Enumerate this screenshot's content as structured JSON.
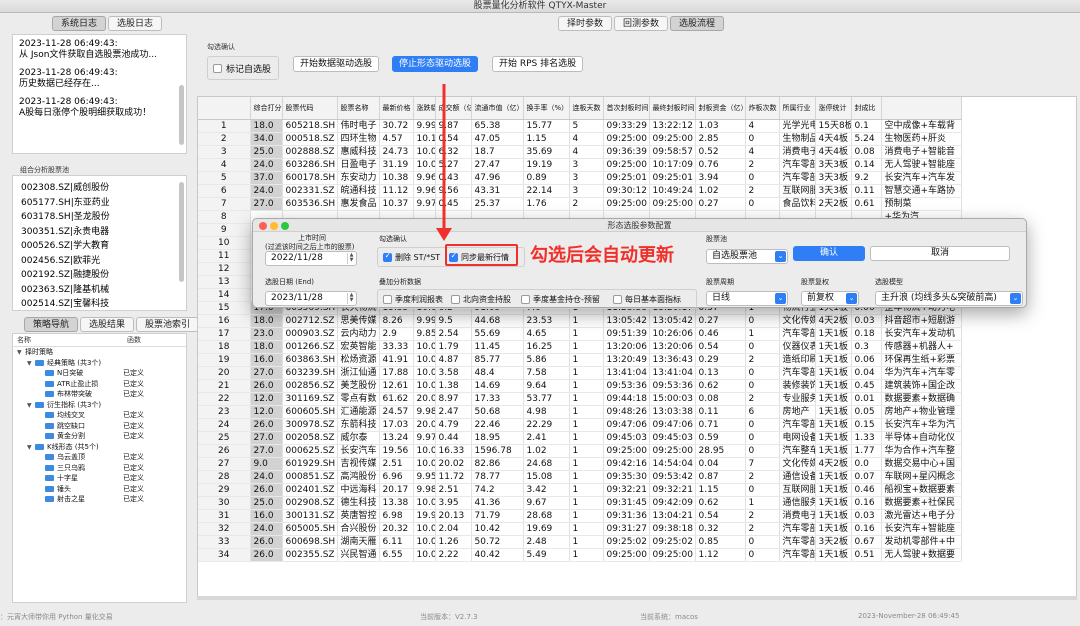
{
  "window": {
    "title": "股票量化分析软件 QTYX-Master"
  },
  "left_tabs": [
    "系统日志",
    "选股日志"
  ],
  "left_tabs_active": 0,
  "top_tabs": [
    "择时参数",
    "回测参数",
    "选股流程"
  ],
  "top_tabs_active": 2,
  "log_entries": [
    {
      "time": "2023-11-28 06:49:43:",
      "msg": "从 Json文件获取自选股票池成功..."
    },
    {
      "time": "2023-11-28 06:49:43:",
      "msg": "历史数据已经存在..."
    },
    {
      "time": "2023-11-28 06:49:43:",
      "msg": "A股每日涨停个股明细获取成功！"
    }
  ],
  "combo_pool_title": "组合分析股票池",
  "stock_pool": [
    "002308.SZ|威创股份",
    "605177.SH|东亚药业",
    "603178.SH|圣龙股份",
    "300351.SZ|永贵电器",
    "000526.SZ|学大教育",
    "002456.SZ|欧菲光",
    "002192.SZ|融捷股份",
    "002363.SZ|隆基机械",
    "002514.SZ|宝馨科技"
  ],
  "strategy_tabs": [
    "策略导航",
    "选股结果",
    "股票池索引"
  ],
  "strategy_tabs_active": 0,
  "tree": {
    "headers": [
      "名称",
      "函数"
    ],
    "rows": [
      {
        "level": 0,
        "arrow": "▼",
        "folder": false,
        "name": "择时策略",
        "type": ""
      },
      {
        "level": 1,
        "arrow": "▼",
        "folder": true,
        "name": "经典策略 (共3个)",
        "type": ""
      },
      {
        "level": 2,
        "arrow": "",
        "folder": true,
        "name": "N日突破",
        "type": "已定义"
      },
      {
        "level": 2,
        "arrow": "",
        "folder": true,
        "name": "ATR止盈止损",
        "type": "已定义"
      },
      {
        "level": 2,
        "arrow": "",
        "folder": true,
        "name": "布林带突破",
        "type": "已定义"
      },
      {
        "level": 1,
        "arrow": "▼",
        "folder": true,
        "name": "衍生指标 (共3个)",
        "type": ""
      },
      {
        "level": 2,
        "arrow": "",
        "folder": true,
        "name": "均线交叉",
        "type": "已定义"
      },
      {
        "level": 2,
        "arrow": "",
        "folder": true,
        "name": "跳空缺口",
        "type": "已定义"
      },
      {
        "level": 2,
        "arrow": "",
        "folder": true,
        "name": "黄金分割",
        "type": "已定义"
      },
      {
        "level": 1,
        "arrow": "▼",
        "folder": true,
        "name": "K线形态 (共5个)",
        "type": ""
      },
      {
        "level": 2,
        "arrow": "",
        "folder": true,
        "name": "乌云盖顶",
        "type": "已定义"
      },
      {
        "level": 2,
        "arrow": "",
        "folder": true,
        "name": "三只乌鸦",
        "type": "已定义"
      },
      {
        "level": 2,
        "arrow": "",
        "folder": true,
        "name": "十字星",
        "type": "已定义"
      },
      {
        "level": 2,
        "arrow": "",
        "folder": true,
        "name": "锤头",
        "type": "已定义"
      },
      {
        "level": 2,
        "arrow": "",
        "folder": true,
        "name": "射击之星",
        "type": "已定义"
      }
    ]
  },
  "select_box": {
    "title": "勾选确认",
    "mark_label": "标记自选股",
    "mark_checked": false
  },
  "buttons": {
    "data_driven": "开始数据驱动选股",
    "stop_pattern": "停止形态驱动选股",
    "rps": "开始 RPS 排名选股"
  },
  "table": {
    "headers": [
      "",
      "综合打分",
      "股票代码",
      "股票名称",
      "最新价格",
      "涨跌幅",
      "成交额（亿）",
      "流通市值（亿）",
      "换手率（%）",
      "连板天数",
      "首次封板时间",
      "最终封板时间",
      "封板资金（亿）",
      "炸板次数",
      "所属行业",
      "涨停统计",
      "封成比",
      ""
    ],
    "rows": [
      [
        "1",
        "18.0",
        "605218.SH",
        "伟时电子",
        "30.72",
        "9.99",
        "9.87",
        "65.38",
        "15.77",
        "5",
        "09:33:29",
        "13:22:12",
        "1.03",
        "4",
        "光学光电",
        "15天8板",
        "0.1",
        "空中成像+车载背"
      ],
      [
        "2",
        "34.0",
        "000518.SZ",
        "四环生物",
        "4.57",
        "10.12",
        "0.54",
        "47.05",
        "1.15",
        "4",
        "09:25:00",
        "09:25:00",
        "2.85",
        "0",
        "生物制品",
        "4天4板",
        "5.24",
        "生物医药+肝炎"
      ],
      [
        "3",
        "25.0",
        "002888.SZ",
        "惠威科技",
        "24.73",
        "10.01",
        "6.32",
        "18.7",
        "35.69",
        "4",
        "09:36:39",
        "09:58:57",
        "0.52",
        "4",
        "消费电子",
        "4天4板",
        "0.08",
        "消费电子+智能音"
      ],
      [
        "4",
        "24.0",
        "603286.SH",
        "日盈电子",
        "31.19",
        "10.02",
        "5.27",
        "27.47",
        "19.19",
        "3",
        "09:25:00",
        "10:17:09",
        "0.76",
        "2",
        "汽车零部",
        "3天3板",
        "0.14",
        "无人驾驶+智能座"
      ],
      [
        "5",
        "37.0",
        "600178.SH",
        "东安动力",
        "10.38",
        "9.96",
        "0.43",
        "47.96",
        "0.89",
        "3",
        "09:25:01",
        "09:25:01",
        "3.94",
        "0",
        "汽车零部",
        "3天3板",
        "9.2",
        "长安汽车+汽车发"
      ],
      [
        "6",
        "24.0",
        "002331.SZ",
        "皖通科技",
        "11.12",
        "9.96",
        "9.56",
        "43.31",
        "22.14",
        "3",
        "09:30:12",
        "10:49:24",
        "1.02",
        "2",
        "互联网服",
        "3天3板",
        "0.11",
        "智慧交通+车路协"
      ],
      [
        "7",
        "27.0",
        "603536.SH",
        "惠发食品",
        "10.37",
        "9.97",
        "0.45",
        "25.37",
        "1.76",
        "2",
        "09:25:00",
        "09:25:00",
        "0.27",
        "0",
        "食品饮料",
        "2天2板",
        "0.61",
        "预制菜"
      ],
      [
        "8",
        "",
        "",
        "",
        "",
        "",
        "",
        "",
        "",
        "",
        "",
        "",
        "",
        "",
        "",
        "",
        "",
        "+华为汽"
      ],
      [
        "9",
        "",
        "",
        "",
        "",
        "",
        "",
        "",
        "",
        "",
        "",
        "",
        "",
        "",
        "",
        "",
        "",
        "+机器相关"
      ],
      [
        "10",
        "",
        "",
        "",
        "",
        "",
        "",
        "",
        "",
        "",
        "",
        "",
        "",
        "",
        "",
        "",
        "",
        "专用设备"
      ],
      [
        "11",
        "",
        "",
        "",
        "",
        "",
        "",
        "",
        "",
        "",
        "",
        "",
        "",
        "",
        "",
        "",
        "",
        "+预制菜"
      ],
      [
        "12",
        "",
        "",
        "",
        "",
        "",
        "",
        "",
        "",
        "",
        "",
        "",
        "",
        "",
        "",
        "",
        "",
        "+华为汽"
      ],
      [
        "13",
        "",
        "",
        "",
        "",
        "",
        "",
        "",
        "",
        "",
        "",
        "",
        "",
        "",
        "",
        "",
        "",
        "洗设备+华"
      ],
      [
        "14",
        "",
        "",
        "",
        "",
        "",
        "",
        "",
        "",
        "",
        "",
        "",
        "",
        "",
        "",
        "",
        "",
        "+宝马热技"
      ],
      [
        "15",
        "17.0",
        "603569.SH",
        "长久物流",
        "15.35",
        "10.04",
        "6.2",
        "91.09",
        "7.0",
        "1",
        "11:28:38",
        "13:20:17",
        "0.37",
        "1",
        "物流行业",
        "1天1板",
        "0.06",
        "整车物流+动力电"
      ],
      [
        "16",
        "18.0",
        "002712.SZ",
        "思美传媒",
        "8.26",
        "9.99",
        "9.5",
        "44.68",
        "23.53",
        "1",
        "13:05:42",
        "13:05:42",
        "0.27",
        "0",
        "文化传媒",
        "4天2板",
        "0.03",
        "抖音超市+短剧游"
      ],
      [
        "17",
        "23.0",
        "000903.SZ",
        "云内动力",
        "2.9",
        "9.85",
        "2.54",
        "55.69",
        "4.65",
        "1",
        "09:51:39",
        "10:26:06",
        "0.46",
        "1",
        "汽车零部",
        "1天1板",
        "0.18",
        "长安汽车+发动机"
      ],
      [
        "18",
        "18.0",
        "001266.SZ",
        "宏英智能",
        "33.33",
        "10.0",
        "1.79",
        "11.45",
        "16.25",
        "1",
        "13:20:06",
        "13:20:06",
        "0.54",
        "0",
        "仪器仪表",
        "1天1板",
        "0.3",
        "传感器+机器人+"
      ],
      [
        "19",
        "16.0",
        "603863.SH",
        "松炀资源",
        "41.91",
        "10.0",
        "4.87",
        "85.77",
        "5.86",
        "1",
        "13:20:49",
        "13:36:43",
        "0.29",
        "2",
        "造纸印刷",
        "1天1板",
        "0.06",
        "环保再生纸+彩票"
      ],
      [
        "20",
        "27.0",
        "603239.SH",
        "浙江仙通",
        "17.88",
        "10.03",
        "3.58",
        "48.4",
        "7.58",
        "1",
        "13:41:04",
        "13:41:04",
        "0.13",
        "0",
        "汽车零部",
        "1天1板",
        "0.04",
        "华为汽车+汽车零"
      ],
      [
        "21",
        "26.0",
        "002856.SZ",
        "美芝股份",
        "12.61",
        "10.03",
        "1.38",
        "14.69",
        "9.64",
        "1",
        "09:53:36",
        "09:53:36",
        "0.62",
        "0",
        "装修装饰",
        "1天1板",
        "0.45",
        "建筑装饰+国企改"
      ],
      [
        "22",
        "12.0",
        "301169.SZ",
        "零点有数",
        "61.62",
        "20.0",
        "8.97",
        "17.33",
        "53.77",
        "1",
        "09:44:18",
        "15:00:03",
        "0.08",
        "2",
        "专业服务",
        "1天1板",
        "0.01",
        "数据要素+数据确"
      ],
      [
        "23",
        "12.0",
        "600605.SH",
        "汇通能源",
        "24.57",
        "9.98",
        "2.47",
        "50.68",
        "4.98",
        "1",
        "09:48:26",
        "13:03:38",
        "0.11",
        "6",
        "房地产",
        "1天1板",
        "0.05",
        "房地产+物业管理"
      ],
      [
        "24",
        "26.0",
        "300978.SZ",
        "东箭科技",
        "17.03",
        "20.01",
        "4.79",
        "22.46",
        "22.29",
        "1",
        "09:47:06",
        "09:47:06",
        "0.71",
        "0",
        "汽车零部",
        "1天1板",
        "0.15",
        "长安汽车+华为汽"
      ],
      [
        "25",
        "27.0",
        "002058.SZ",
        "威尔泰",
        "13.24",
        "9.97",
        "0.44",
        "18.95",
        "2.41",
        "1",
        "09:45:03",
        "09:45:03",
        "0.59",
        "0",
        "电网设备",
        "1天1板",
        "1.33",
        "半导体+自动化仪"
      ],
      [
        "26",
        "27.0",
        "000625.SZ",
        "长安汽车",
        "19.56",
        "10.01",
        "16.33",
        "1596.78",
        "1.02",
        "1",
        "09:25:00",
        "09:25:00",
        "28.95",
        "0",
        "汽车整车",
        "1天1板",
        "1.77",
        "华为合作+汽车整"
      ],
      [
        "27",
        "9.0",
        "601929.SH",
        "吉视传媒",
        "2.51",
        "10.09",
        "20.02",
        "82.86",
        "24.68",
        "1",
        "09:42:16",
        "14:54:04",
        "0.04",
        "7",
        "文化传媒",
        "4天2板",
        "0.0",
        "数据交易中心+国"
      ],
      [
        "28",
        "24.0",
        "000851.SZ",
        "高鸿股份",
        "6.96",
        "9.95",
        "11.72",
        "78.77",
        "15.08",
        "1",
        "09:35:30",
        "09:53:42",
        "0.87",
        "2",
        "通信设备",
        "1天1板",
        "0.07",
        "车联网+星闪概念"
      ],
      [
        "29",
        "26.0",
        "002401.SZ",
        "中远海科",
        "20.17",
        "9.98",
        "2.51",
        "74.2",
        "3.42",
        "1",
        "09:32:21",
        "09:32:21",
        "1.15",
        "0",
        "互联网服",
        "1天1板",
        "0.46",
        "船视宝+数据要素"
      ],
      [
        "30",
        "25.0",
        "002908.SZ",
        "德生科技",
        "13.38",
        "10.03",
        "3.95",
        "41.36",
        "9.67",
        "1",
        "09:31:45",
        "09:42:09",
        "0.62",
        "1",
        "通信服务",
        "1天1板",
        "0.16",
        "数据要素+社保民"
      ],
      [
        "31",
        "16.0",
        "300131.SZ",
        "英唐智控",
        "6.98",
        "19.93",
        "20.13",
        "71.79",
        "28.68",
        "1",
        "09:31:36",
        "13:04:21",
        "0.54",
        "2",
        "消费电子",
        "1天1板",
        "0.03",
        "激光雷达+电子分"
      ],
      [
        "32",
        "24.0",
        "605005.SH",
        "合兴股份",
        "20.32",
        "10.02",
        "2.04",
        "10.42",
        "19.69",
        "1",
        "09:31:27",
        "09:38:18",
        "0.32",
        "2",
        "汽车零部",
        "1天1板",
        "0.16",
        "长安汽车+智能座"
      ],
      [
        "33",
        "26.0",
        "600698.SH",
        "湖南天雁",
        "6.11",
        "10.09",
        "1.26",
        "50.72",
        "2.48",
        "1",
        "09:25:02",
        "09:25:02",
        "0.85",
        "0",
        "汽车零部",
        "3天2板",
        "0.67",
        "发动机零部件+中"
      ],
      [
        "34",
        "26.0",
        "002355.SZ",
        "兴民智通",
        "6.55",
        "10.08",
        "2.22",
        "40.42",
        "5.49",
        "1",
        "09:25:00",
        "09:25:00",
        "1.12",
        "0",
        "汽车零部",
        "1天1板",
        "0.51",
        "无人驾驶+数据要"
      ]
    ]
  },
  "dialog": {
    "title": "形态选股参数配置",
    "listing_label": "上市时间",
    "listing_note": "(过滤该时间之后上市的股票)",
    "listing_date": "2022/11/28",
    "confirm_label": "勾选确认",
    "opt_remove_st": "删除 ST/*ST",
    "opt_remove_st_checked": true,
    "opt_sync": "同步最新行情",
    "opt_sync_checked": true,
    "pool_label": "股票池",
    "pool_value": "自选股票池",
    "ok": "确认",
    "cancel": "取消",
    "end_label": "选股日期 (End)",
    "end_date": "2023/11/28",
    "overlay_label": "叠加分析数据",
    "overlays": [
      {
        "label": "季度利润报表",
        "checked": false
      },
      {
        "label": "北向资金持股",
        "checked": false
      },
      {
        "label": "季度基金持仓-预留",
        "checked": false
      },
      {
        "label": "每日基本面指标",
        "checked": false
      }
    ],
    "period_label": "股票周期",
    "period_value": "日线",
    "adjust_label": "股票复权",
    "adjust_value": "前复权",
    "model_label": "选股模型",
    "model_value": "主升浪 (均线多头&突破前高)"
  },
  "annotation": "勾选后会自动更新",
  "status": {
    "left": "：元宵大师带你用 Python 量化交易",
    "version": "当前版本：V2.7.3",
    "system": "当前系统：macos",
    "time": "2023-November-28 06:49:45"
  },
  "colors": {
    "accent": "#2f7ef5",
    "annotation": "#f0302a"
  }
}
